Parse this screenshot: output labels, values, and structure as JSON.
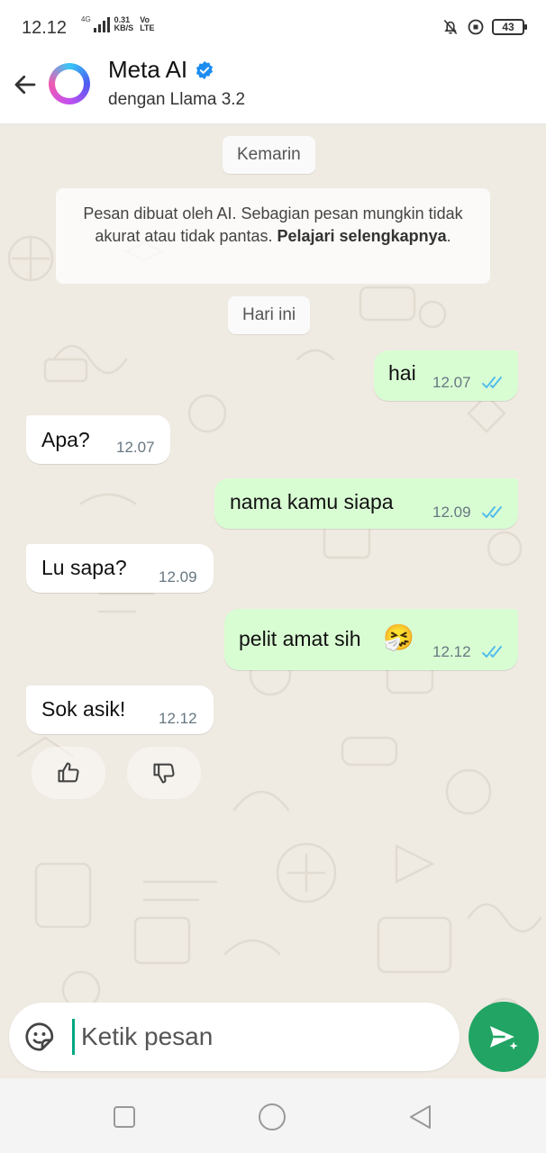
{
  "status_bar": {
    "time": "12.12",
    "network_type": "4G",
    "speed_value": "0.31",
    "speed_unit": "KB/S",
    "volte_top": "Vo",
    "volte_bottom": "LTE",
    "battery": "43",
    "icons": [
      "bell-off-icon",
      "data-saver-icon",
      "battery-icon"
    ]
  },
  "header": {
    "title": "Meta AI",
    "subtitle": "dengan Llama 3.2",
    "verified_icon": "verified-badge-icon",
    "back_icon": "arrow-left-icon"
  },
  "chat": {
    "date_yesterday": "Kemarin",
    "notice_text": "Pesan dibuat oleh AI. Sebagian pesan mungkin tidak akurat atau tidak pantas. ",
    "notice_link": "Pelajari selengkapnya",
    "notice_end": ".",
    "date_today": "Hari ini",
    "messages": [
      {
        "direction": "out",
        "text": "hai",
        "time": "12.07",
        "status": "read"
      },
      {
        "direction": "in",
        "text": "Apa?",
        "time": "12.07"
      },
      {
        "direction": "out",
        "text": "nama kamu siapa",
        "time": "12.09",
        "status": "read"
      },
      {
        "direction": "in",
        "text": "Lu sapa?",
        "time": "12.09"
      },
      {
        "direction": "out",
        "text": "pelit amat sih",
        "emoji": "🤧",
        "time": "12.12",
        "status": "read"
      },
      {
        "direction": "in",
        "text": "Sok asik!",
        "time": "12.12"
      }
    ],
    "reactions": [
      "thumbs-up-icon",
      "thumbs-down-icon"
    ]
  },
  "composer": {
    "placeholder": "Ketik pesan",
    "value": "",
    "sticker_icon": "sticker-icon",
    "send_icon": "send-ai-icon"
  },
  "colors": {
    "outgoing_bubble": "#d9fdd3",
    "incoming_bubble": "#ffffff",
    "chat_background": "#efeae2",
    "send_button": "#21a464",
    "read_ticks": "#53bdeb",
    "verified": "#1d8cf0"
  }
}
